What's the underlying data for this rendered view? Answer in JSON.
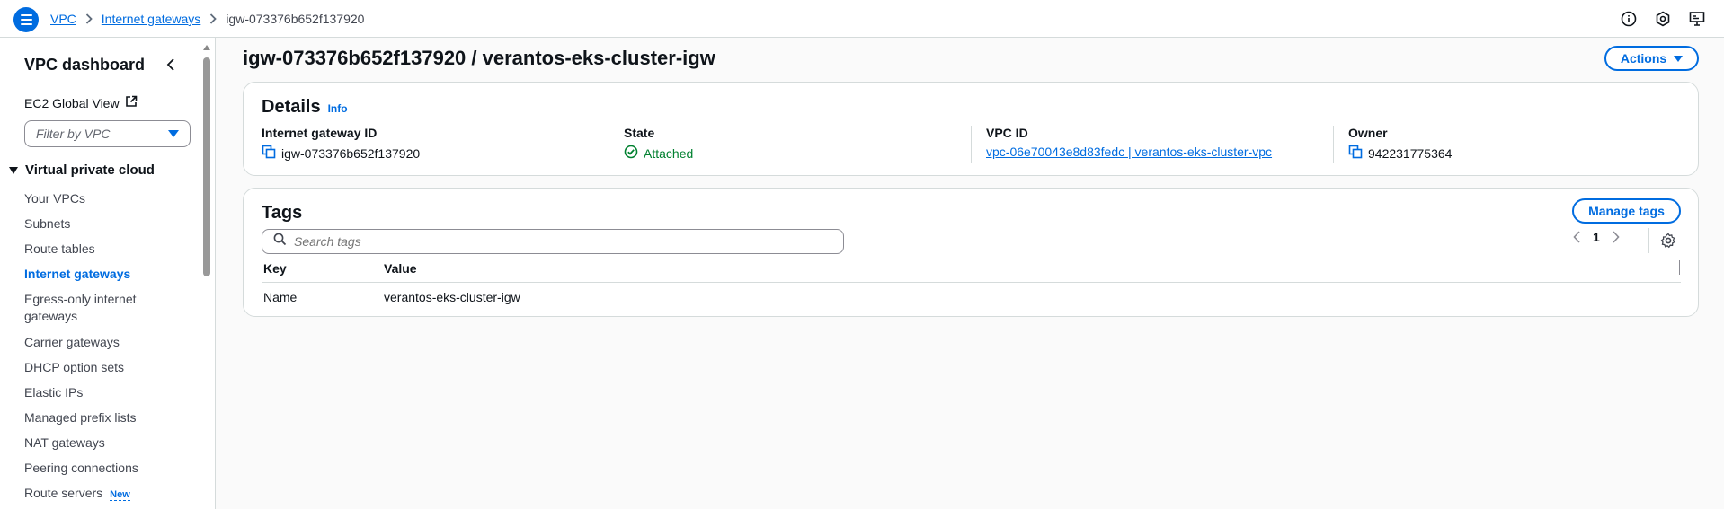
{
  "breadcrumb": {
    "items": [
      "VPC",
      "Internet gateways"
    ],
    "current": "igw-073376b652f137920"
  },
  "sidebar": {
    "title": "VPC dashboard",
    "ec2_global_view": "EC2 Global View",
    "filter_placeholder": "Filter by VPC",
    "section": "Virtual private cloud",
    "items": [
      {
        "label": "Your VPCs"
      },
      {
        "label": "Subnets"
      },
      {
        "label": "Route tables"
      },
      {
        "label": "Internet gateways"
      },
      {
        "label": "Egress-only internet gateways"
      },
      {
        "label": "Carrier gateways"
      },
      {
        "label": "DHCP option sets"
      },
      {
        "label": "Elastic IPs"
      },
      {
        "label": "Managed prefix lists"
      },
      {
        "label": "NAT gateways"
      },
      {
        "label": "Peering connections"
      },
      {
        "label": "Route servers",
        "badge": "New"
      }
    ],
    "active_item": "Internet gateways"
  },
  "main": {
    "title": "igw-073376b652f137920 / verantos-eks-cluster-igw",
    "actions_label": "Actions",
    "details": {
      "heading": "Details",
      "info": "Info",
      "fields": [
        {
          "label": "Internet gateway ID",
          "value": "igw-073376b652f137920"
        },
        {
          "label": "State",
          "value": "Attached"
        },
        {
          "label": "VPC ID",
          "value": "vpc-06e70043e8d83fedc | verantos-eks-cluster-vpc"
        },
        {
          "label": "Owner",
          "value": "942231775364"
        }
      ]
    },
    "tags": {
      "heading": "Tags",
      "manage_label": "Manage tags",
      "search_placeholder": "Search tags",
      "page": "1",
      "columns": [
        "Key",
        "Value"
      ],
      "rows": [
        {
          "key": "Name",
          "value": "verantos-eks-cluster-igw"
        }
      ]
    }
  },
  "colors": {
    "accent": "#006ce0",
    "success": "#00802f"
  }
}
